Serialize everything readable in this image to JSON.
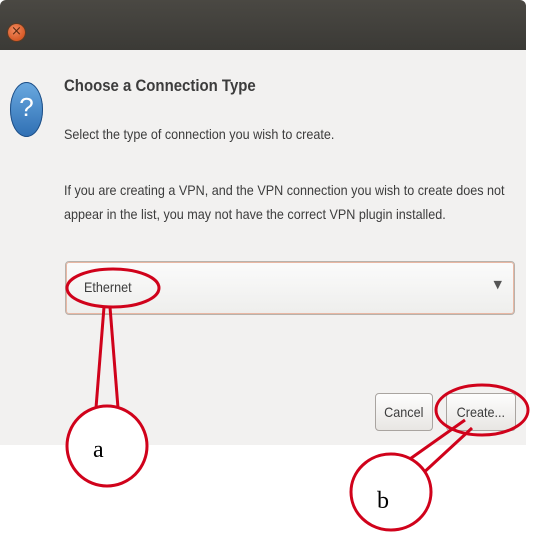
{
  "window": {
    "close_icon": "close-icon"
  },
  "dialog": {
    "icon": "question-icon",
    "title": "Choose a Connection Type",
    "instruction": "Select the type of connection you wish to create.",
    "note_lines": [
      "If you are creating a VPN, and the VPN connection you wish to create does not",
      "appear in the list, you may not have the correct VPN plugin installed."
    ],
    "connection_type_select": {
      "selected": "Ethernet",
      "arrow_icon": "dropdown-arrow-icon"
    },
    "buttons": {
      "cancel": "Cancel",
      "create": "Create..."
    }
  },
  "annotations": {
    "label_a": "a",
    "label_b": "b",
    "color": "#d0021b"
  }
}
